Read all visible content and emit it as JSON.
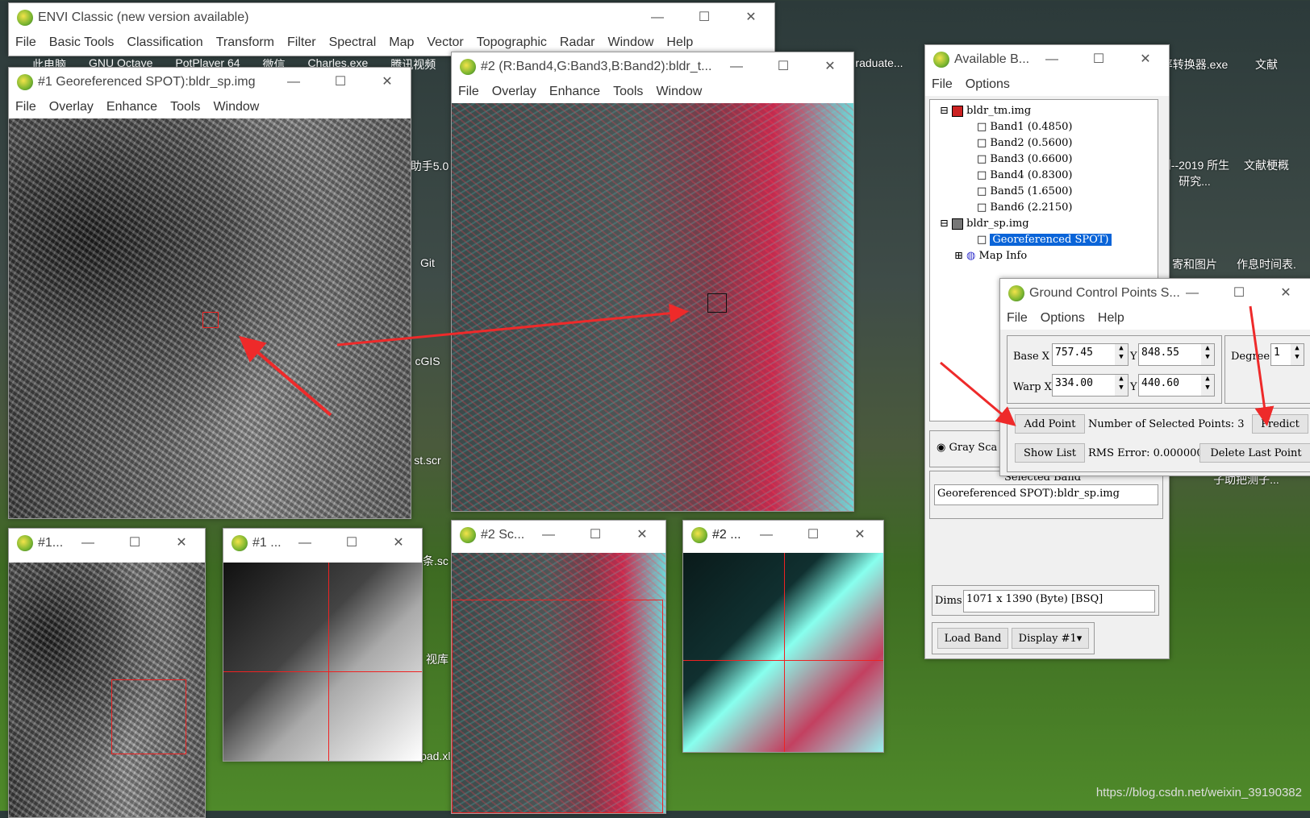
{
  "desktop": {
    "icons": [
      "raduate...",
      "率转换器.exe",
      "文献",
      "则--2019 所生研究...",
      "文献梗概",
      "寄和图片",
      "作息时间表.",
      "Git",
      "cGIS",
      "st.scr",
      "条.sc",
      "视库",
      "ipad.xlsx",
      "子助把测子...",
      "助手5.0",
      "此电脑",
      "GNU Octave",
      "PotPlayer 64",
      "微信",
      "Charles.exe",
      "腾讯视频"
    ],
    "watermark": "https://blog.csdn.net/weixin_39190382"
  },
  "envi": {
    "title": "ENVI Classic (new version available)",
    "menu": [
      "File",
      "Basic Tools",
      "Classification",
      "Transform",
      "Filter",
      "Spectral",
      "Map",
      "Vector",
      "Topographic",
      "Radar",
      "Window",
      "Help"
    ]
  },
  "display1": {
    "title": "#1 Georeferenced SPOT):bldr_sp.img",
    "menu": [
      "File",
      "Overlay",
      "Enhance",
      "Tools",
      "Window"
    ]
  },
  "display2": {
    "title": "#2 (R:Band4,G:Band3,B:Band2):bldr_t...",
    "menu": [
      "File",
      "Overlay",
      "Enhance",
      "Tools",
      "Window"
    ]
  },
  "scroll1": {
    "title": "#1..."
  },
  "zoom1": {
    "title": "#1 ..."
  },
  "scroll2": {
    "title": "#2 Sc..."
  },
  "zoom2": {
    "title": "#2 ..."
  },
  "bands": {
    "title": "Available B...",
    "menu": [
      "File",
      "Options"
    ],
    "tree": {
      "file1": "bldr_tm.img",
      "bands": [
        "Band1 (0.4850)",
        "Band2 (0.5600)",
        "Band3 (0.6600)",
        "Band4 (0.8300)",
        "Band5 (1.6500)",
        "Band6 (2.2150)"
      ],
      "file2": "bldr_sp.img",
      "selected": "Georeferenced SPOT)",
      "mapinfo": "Map Info"
    },
    "gray_scale": "Gray Sca",
    "selected_band_label": "Selected Band",
    "selected_band": "Georeferenced SPOT):bldr_sp.img",
    "dims_label": "Dims",
    "dims": "1071 x 1390 (Byte) [BSQ]",
    "load_band": "Load Band",
    "display": "Display #1"
  },
  "gcp": {
    "title": "Ground Control Points S...",
    "menu": [
      "File",
      "Options",
      "Help"
    ],
    "base_label": "Base X",
    "warp_label": "Warp X",
    "y_label": "Y",
    "base_x": "757.45",
    "base_y": "848.55",
    "warp_x": "334.00",
    "warp_y": "440.60",
    "degree_label": "Degree",
    "degree": "1",
    "add_point": "Add Point",
    "num_selected": "Number of Selected Points: 3",
    "predict": "Predict",
    "show_list": "Show List",
    "rms": "RMS Error: 0.000000",
    "delete_last": "Delete Last Point"
  },
  "colors": {
    "selection": "#0a64d8",
    "arrow": "#ee2a2a"
  }
}
